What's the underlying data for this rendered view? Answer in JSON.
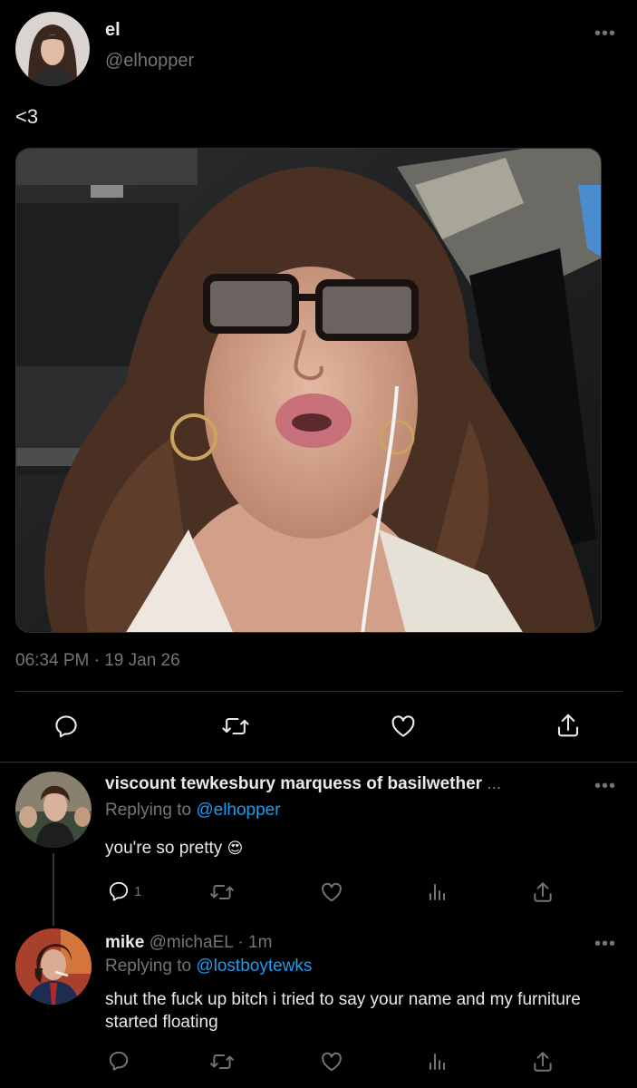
{
  "main_tweet": {
    "author_name": "el",
    "author_handle": "@elhopper",
    "text": "<3",
    "time": "06:34 PM",
    "date": "19 Jan 26",
    "meta_separator": " · "
  },
  "replies": [
    {
      "name": "viscount tewkesbury marquess of basilwether",
      "name_ellipsis": "...",
      "replying_prefix": "Replying to",
      "replying_handle": "@elhopper",
      "text": "you're so pretty",
      "emoji": "😍",
      "reply_count": "1"
    },
    {
      "name": "mike",
      "handle": "@michaEL",
      "age": "1m",
      "separator": " · ",
      "replying_prefix": "Replying to",
      "replying_handle": "@lostboytewks",
      "text": "shut the fuck up bitch i tried to say your name and my furniture started floating"
    }
  ],
  "icons": {
    "more": "more-icon",
    "reply": "reply-icon",
    "retweet": "retweet-icon",
    "like": "like-icon",
    "share": "share-icon",
    "analytics": "analytics-icon"
  },
  "colors": {
    "background": "#000000",
    "text": "#e7e9ea",
    "muted": "#71767b",
    "link": "#1d9bf0",
    "divider": "#2f3336"
  }
}
